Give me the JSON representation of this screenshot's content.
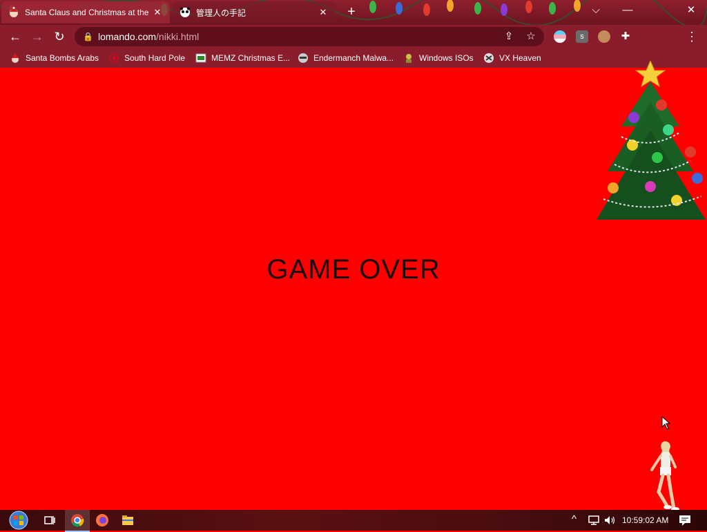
{
  "browser": {
    "tabs": [
      {
        "title": "Santa Claus and Christmas at the",
        "active": true
      },
      {
        "title": "管理人の手記",
        "active": false
      }
    ],
    "new_tab_label": "+",
    "url_host": "lomando.com",
    "url_path": "/nikki.html",
    "window_controls": {
      "dropdown": "⌵",
      "minimize": "—",
      "close": "✕"
    }
  },
  "bookmarks": [
    {
      "label": "Santa Bombs Arabs"
    },
    {
      "label": "South Hard Pole"
    },
    {
      "label": "MEMZ Christmas E..."
    },
    {
      "label": "Endermanch Malwa..."
    },
    {
      "label": "Windows ISOs"
    },
    {
      "label": "VX Heaven"
    }
  ],
  "page": {
    "message": "GAME OVER",
    "background_color": "#ff0000"
  },
  "taskbar": {
    "clock": "10:59:02 AM"
  },
  "colors": {
    "accent": "#8a1d2c",
    "page_bg": "#ff0000"
  }
}
